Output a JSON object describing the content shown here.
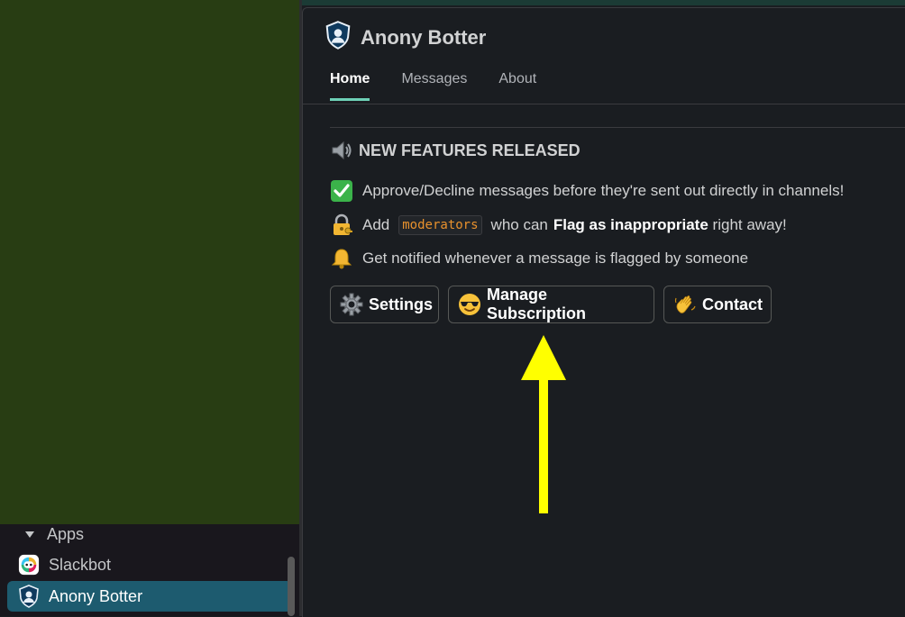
{
  "sidebar": {
    "section_label": "Apps",
    "items": [
      {
        "label": "Slackbot",
        "icon": "slackbot-icon",
        "active": false
      },
      {
        "label": "Anony Botter",
        "icon": "anony-botter-shield-icon",
        "active": true
      }
    ]
  },
  "app": {
    "title": "Anony Botter",
    "icon": "anony-botter-shield-icon",
    "tabs": [
      {
        "label": "Home",
        "active": true
      },
      {
        "label": "Messages",
        "active": false
      },
      {
        "label": "About",
        "active": false
      }
    ]
  },
  "home": {
    "heading": "NEW FEATURES RELEASED",
    "heading_icon": "speaker-icon",
    "features": [
      {
        "icon": "check-mark-icon",
        "text": "Approve/Decline messages before they're sent out directly in channels!"
      },
      {
        "icon": "lock-key-icon",
        "prefix": "Add",
        "code": "moderators",
        "middle": "who can",
        "bold": "Flag as inappropriate",
        "suffix": "right away!"
      },
      {
        "icon": "bell-icon",
        "text": "Get notified whenever a message is flagged by someone"
      }
    ],
    "buttons": [
      {
        "label": "Settings",
        "icon": "gear-icon"
      },
      {
        "label": "Manage Subscription",
        "icon": "sunglasses-face-icon"
      },
      {
        "label": "Contact",
        "icon": "waving-hand-icon"
      }
    ]
  },
  "annotation": {
    "icon": "yellow-arrow-up-icon",
    "color": "#ffff00"
  },
  "colors": {
    "active_item": "#1d5b6f",
    "tab_underline": "#6ed1b7",
    "code_text": "#e8912d"
  }
}
